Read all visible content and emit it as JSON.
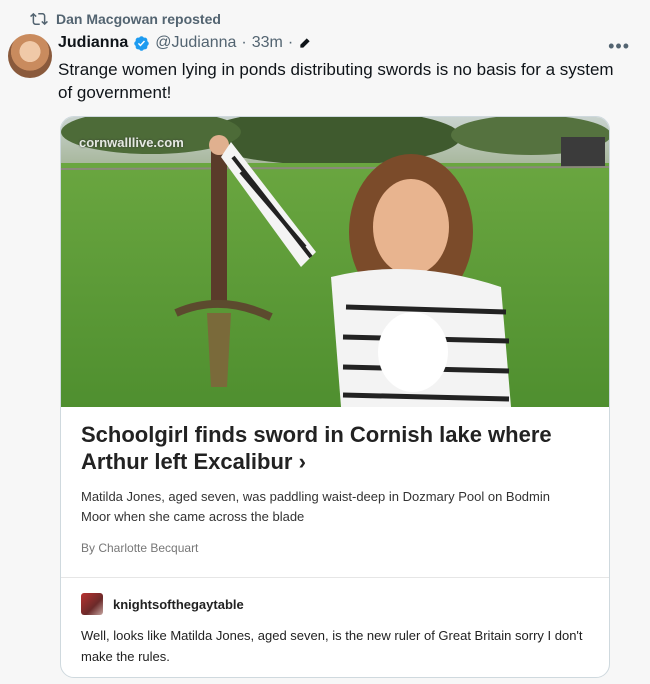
{
  "repost": {
    "label": "Dan Macgowan reposted"
  },
  "post": {
    "display_name": "Judianna",
    "handle": "@Judianna",
    "separator": "·",
    "time": "33m",
    "text": "Strange women lying in ponds distributing swords is no basis for a system of government!"
  },
  "card": {
    "watermark": "cornwalllive.com",
    "headline": "Schoolgirl finds sword in Cornish lake where Arthur left Excalibur",
    "chevron": "›",
    "summary": "Matilda Jones, aged seven, was paddling waist-deep in Dozmary Pool on Bodmin Moor when she came across the blade",
    "byline": "By Charlotte Becquart",
    "comment": {
      "username": "knightsofthegaytable",
      "text": "Well, looks like Matilda Jones, aged seven, is the new ruler of Great Britain sorry I don't make the rules."
    }
  },
  "icons": {
    "repost": "repost-icon",
    "verified": "verified-icon",
    "edit": "edit-icon",
    "more": "more-icon"
  },
  "colors": {
    "accent": "#1d9bf0",
    "muted_text": "#536471",
    "grass": "#5f9b3a"
  }
}
